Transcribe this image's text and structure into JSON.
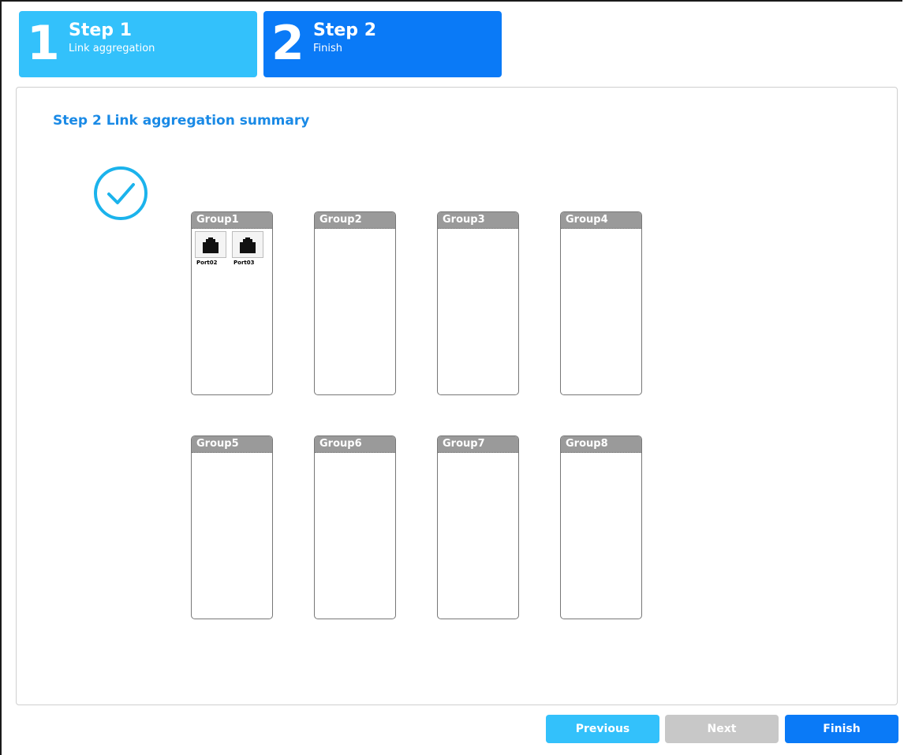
{
  "wizard": {
    "steps": [
      {
        "number": "1",
        "title": "Step 1",
        "subtitle": "Link aggregation",
        "color": "#33c1fb"
      },
      {
        "number": "2",
        "title": "Step 2",
        "subtitle": "Finish",
        "color": "#0a7af7"
      }
    ]
  },
  "panel": {
    "title": "Step 2 Link aggregation summary",
    "status_icon": "check-circle-icon",
    "accent": "#1a8ae6"
  },
  "groups": [
    {
      "name": "Group1",
      "ports": [
        "Port02",
        "Port03"
      ]
    },
    {
      "name": "Group2",
      "ports": []
    },
    {
      "name": "Group3",
      "ports": []
    },
    {
      "name": "Group4",
      "ports": []
    },
    {
      "name": "Group5",
      "ports": []
    },
    {
      "name": "Group6",
      "ports": []
    },
    {
      "name": "Group7",
      "ports": []
    },
    {
      "name": "Group8",
      "ports": []
    }
  ],
  "buttons": {
    "previous": "Previous",
    "next": "Next",
    "finish": "Finish"
  }
}
